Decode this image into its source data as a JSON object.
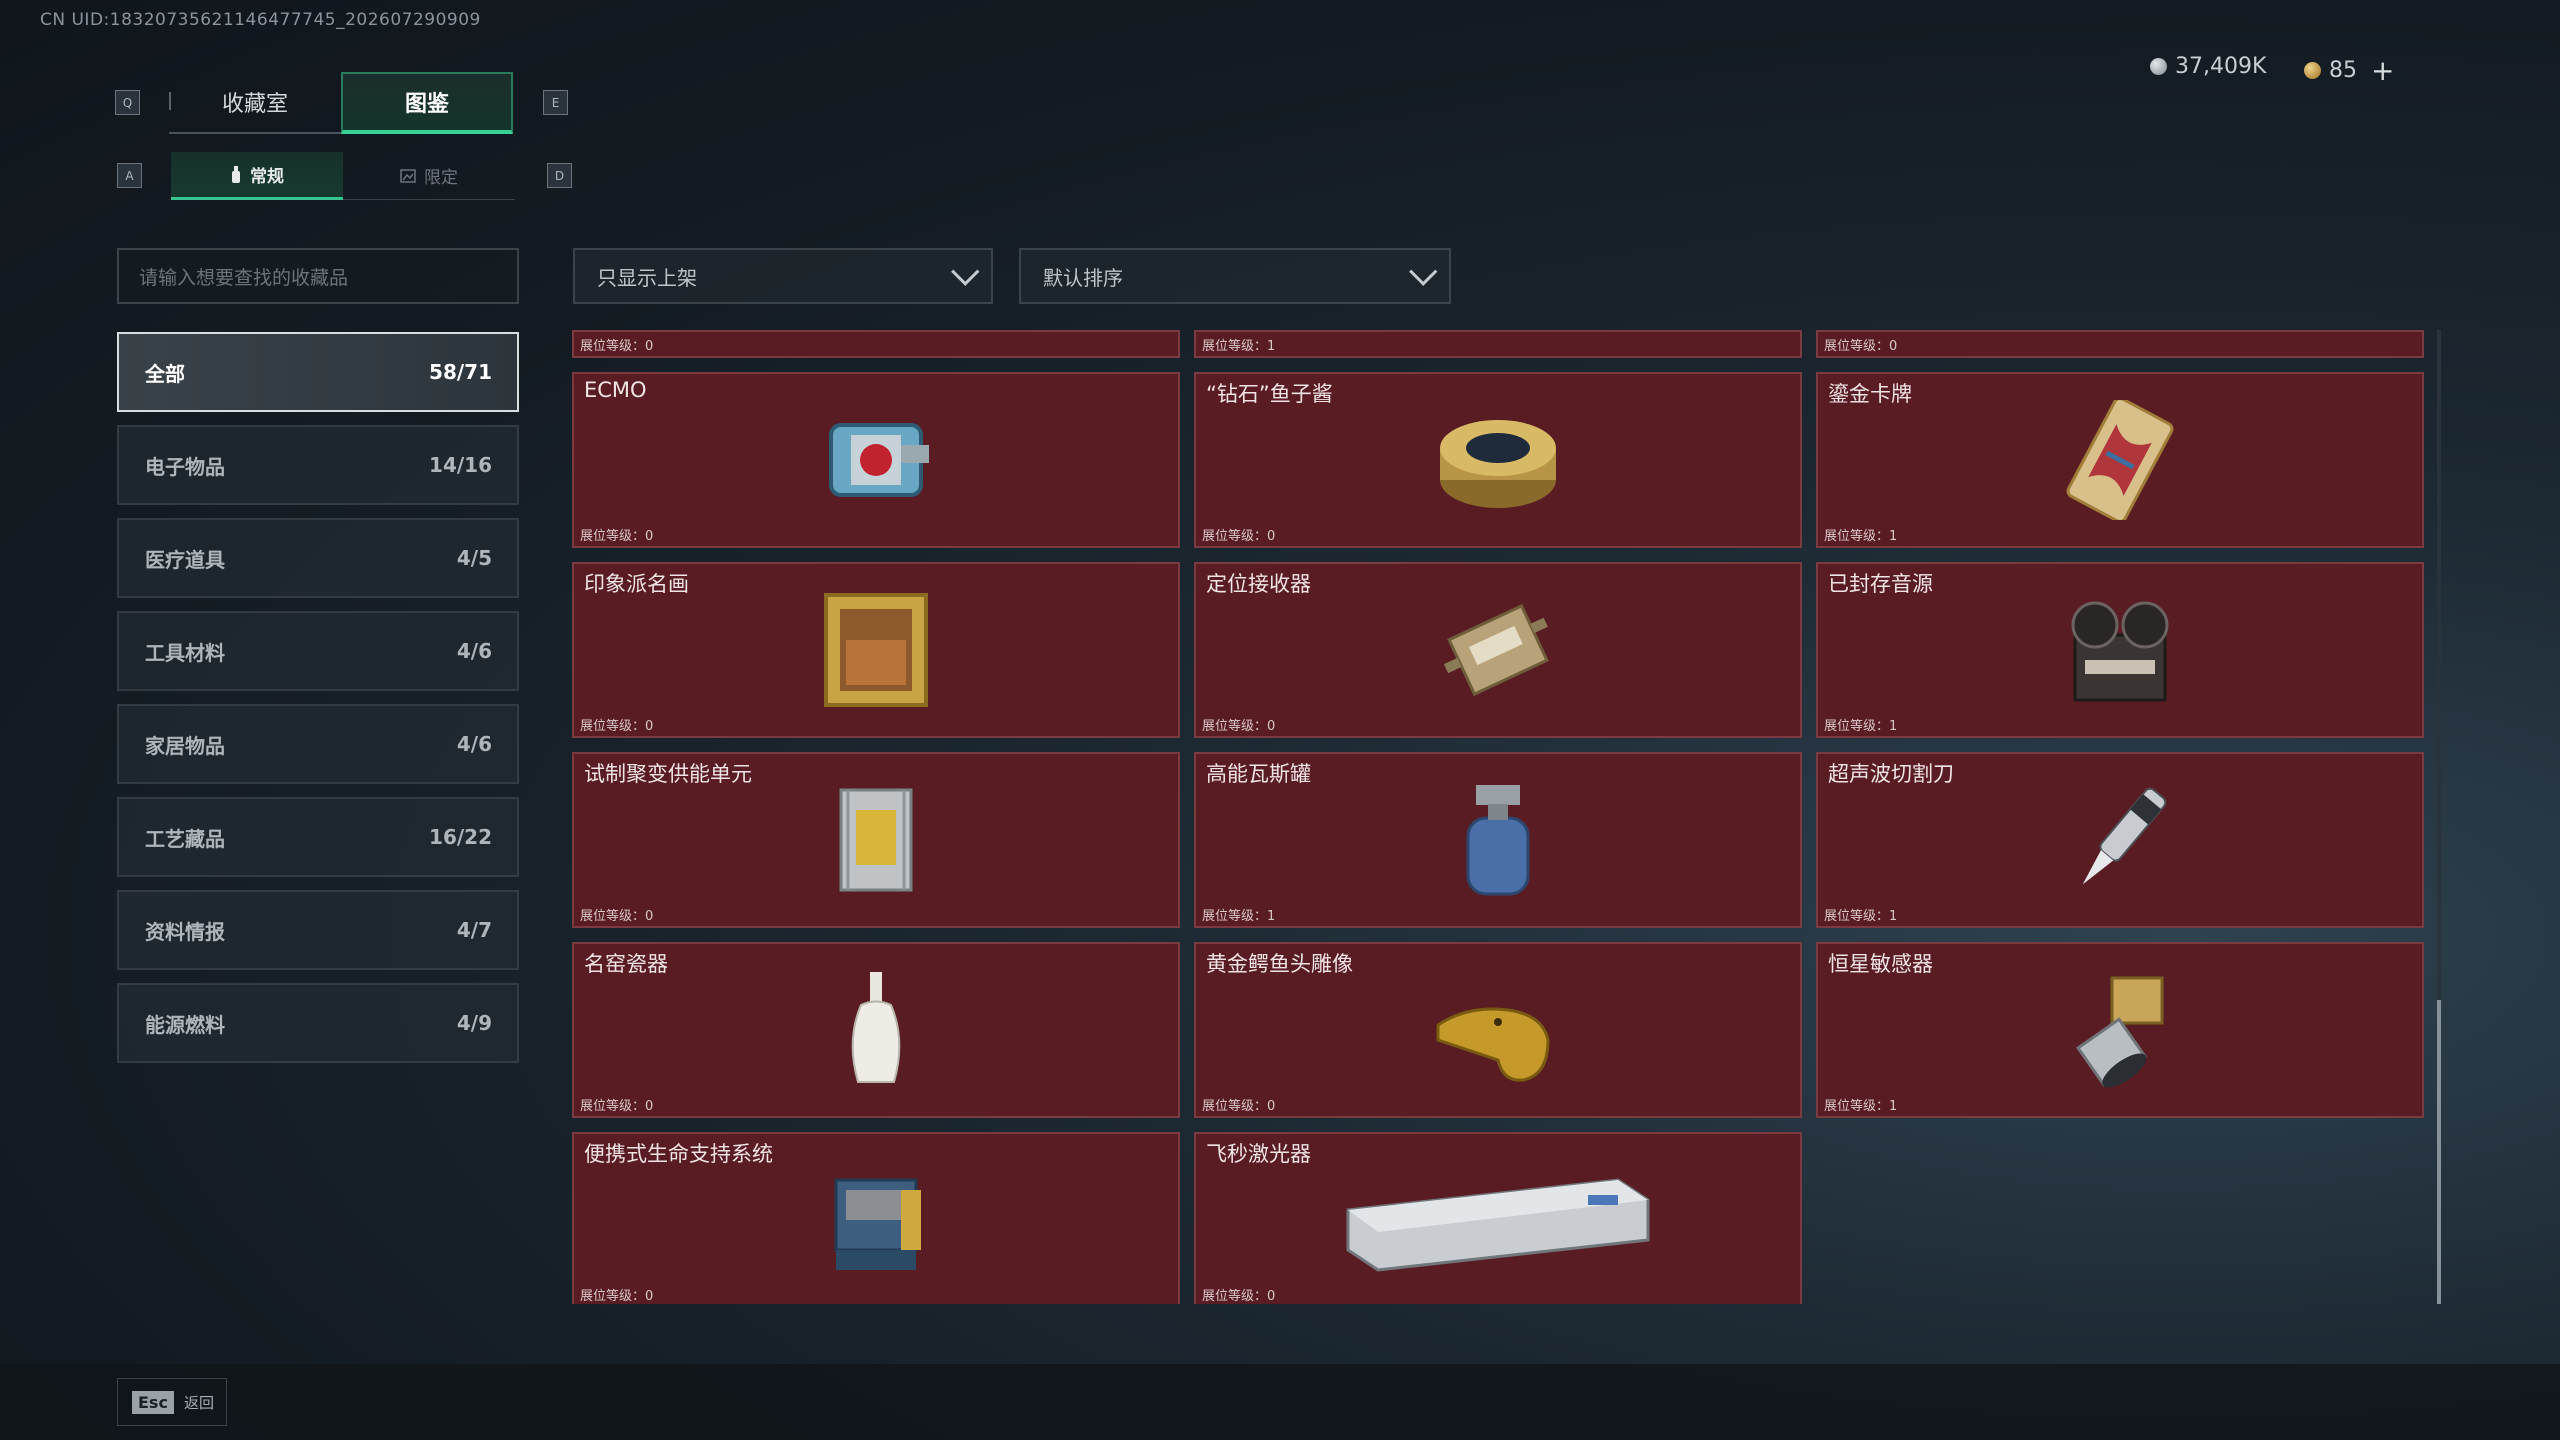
{
  "uid_text": "CN UID:18320735621146477745_202607290909",
  "keys": {
    "q": "Q",
    "e": "E",
    "a": "A",
    "d": "D"
  },
  "main_tabs": [
    {
      "label": "收藏室"
    },
    {
      "label": "图鉴"
    }
  ],
  "sub_tabs": [
    {
      "label": "常规"
    },
    {
      "label": "限定"
    }
  ],
  "currency": {
    "silver": "37,409K",
    "gold": "85",
    "plus": "+"
  },
  "search": {
    "placeholder": "请输入想要查找的收藏品"
  },
  "categories": [
    {
      "label": "全部",
      "count": "58/71"
    },
    {
      "label": "电子物品",
      "count": "14/16"
    },
    {
      "label": "医疗道具",
      "count": "4/5"
    },
    {
      "label": "工具材料",
      "count": "4/6"
    },
    {
      "label": "家居物品",
      "count": "4/6"
    },
    {
      "label": "工艺藏品",
      "count": "16/22"
    },
    {
      "label": "资料情报",
      "count": "4/7"
    },
    {
      "label": "能源燃料",
      "count": "4/9"
    }
  ],
  "filters": {
    "display": "只显示上架",
    "sort": "默认排序"
  },
  "top_partial": [
    {
      "level": "展位等级：0"
    },
    {
      "level": "展位等级：1"
    },
    {
      "level": "展位等级：0"
    }
  ],
  "items": [
    {
      "name": "ECMO",
      "level": "展位等级：0",
      "icon": "ecmo-machine-icon"
    },
    {
      "name": "“钻石”鱼子酱",
      "level": "展位等级：0",
      "icon": "caviar-tin-icon"
    },
    {
      "name": "鎏金卡牌",
      "level": "展位等级：1",
      "icon": "gilded-card-icon"
    },
    {
      "name": "印象派名画",
      "level": "展位等级：0",
      "icon": "framed-painting-icon"
    },
    {
      "name": "定位接收器",
      "level": "展位等级：0",
      "icon": "positioning-receiver-icon"
    },
    {
      "name": "已封存音源",
      "level": "展位等级：1",
      "icon": "reel-recorder-icon"
    },
    {
      "name": "试制聚变供能单元",
      "level": "展位等级：0",
      "icon": "fusion-cell-icon"
    },
    {
      "name": "高能瓦斯罐",
      "level": "展位等级：1",
      "icon": "gas-canister-icon"
    },
    {
      "name": "超声波切割刀",
      "level": "展位等级：1",
      "icon": "ultrasonic-knife-icon"
    },
    {
      "name": "名窑瓷器",
      "level": "展位等级：0",
      "icon": "porcelain-vase-icon"
    },
    {
      "name": "黄金鳄鱼头雕像",
      "level": "展位等级：0",
      "icon": "golden-crocodile-icon"
    },
    {
      "name": "恒星敏感器",
      "level": "展位等级：1",
      "icon": "star-sensor-icon"
    },
    {
      "name": "便携式生命支持系统",
      "level": "展位等级：0",
      "icon": "life-support-icon"
    },
    {
      "name": "飞秒激光器",
      "level": "展位等级：0",
      "icon": "femtosecond-laser-icon"
    }
  ],
  "footer": {
    "esc_key": "Esc",
    "back_label": "返回"
  },
  "colors": {
    "accent": "#37d195",
    "card_bg": "#5a1c23",
    "card_border": "#7a3a40"
  }
}
